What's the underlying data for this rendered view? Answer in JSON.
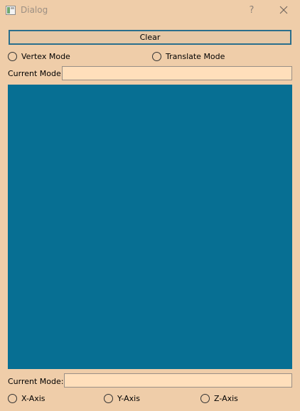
{
  "window": {
    "title": "Dialog",
    "help_glyph": "?",
    "icons": {
      "app": "window-app-icon",
      "close": "close-icon"
    }
  },
  "toolbar": {
    "clear_label": "Clear"
  },
  "modes": {
    "vertex_label": "Vertex Mode",
    "translate_label": "Translate Mode",
    "vertex_checked": false,
    "translate_checked": false
  },
  "top_status": {
    "label": "Current Mode:",
    "value": ""
  },
  "viewport": {
    "background": "#076F93"
  },
  "bottom_status": {
    "label": "Current Mode:",
    "value": ""
  },
  "axes": {
    "x_label": "X-Axis",
    "y_label": "Y-Axis",
    "z_label": "Z-Axis",
    "x_checked": false,
    "y_checked": false,
    "z_checked": false
  },
  "colors": {
    "window_bg": "#EFCDA9",
    "field_bg": "#FFDFBB",
    "accent_border": "#2B6F8C",
    "canvas": "#076F93"
  }
}
